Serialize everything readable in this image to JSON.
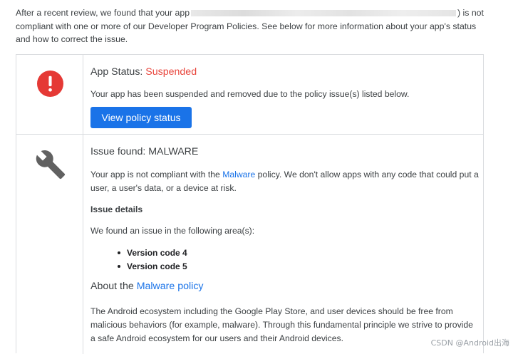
{
  "intro": {
    "prefix": "After a recent review, we found that your app",
    "suffix": ") is not compliant with one or more of our Developer Program Policies. See below for more information about your app's status and how to correct the issue."
  },
  "status_row": {
    "icon": "alert-circle-icon",
    "heading_label": "App Status: ",
    "status_value": "Suspended",
    "status_color": "#e8453c",
    "description": "Your app has been suspended and removed due to the policy issue(s) listed below.",
    "button_label": "View policy status",
    "button_color": "#1a73e8"
  },
  "issue_row": {
    "icon": "wrench-icon",
    "heading": "Issue found: MALWARE",
    "description_before": "Your app is not compliant with the ",
    "description_link": "Malware",
    "description_after": " policy. We don't allow apps with any code that could put a user, a user's data, or a device at risk.",
    "details_title": "Issue details",
    "details_intro": "We found an issue in the following area(s):",
    "areas": [
      "Version code 4",
      "Version code 5"
    ],
    "about_prefix": "About the ",
    "about_link": "Malware policy",
    "about_text": "The Android ecosystem including the Google Play Store, and user devices should be free from malicious behaviors (for example, malware). Through this fundamental principle we strive to provide a safe Android ecosystem for our users and their Android devices."
  },
  "watermark": "CSDN @Android出海",
  "colors": {
    "link": "#1a73e8",
    "border": "#dadce0",
    "alert_red": "#e53935"
  }
}
